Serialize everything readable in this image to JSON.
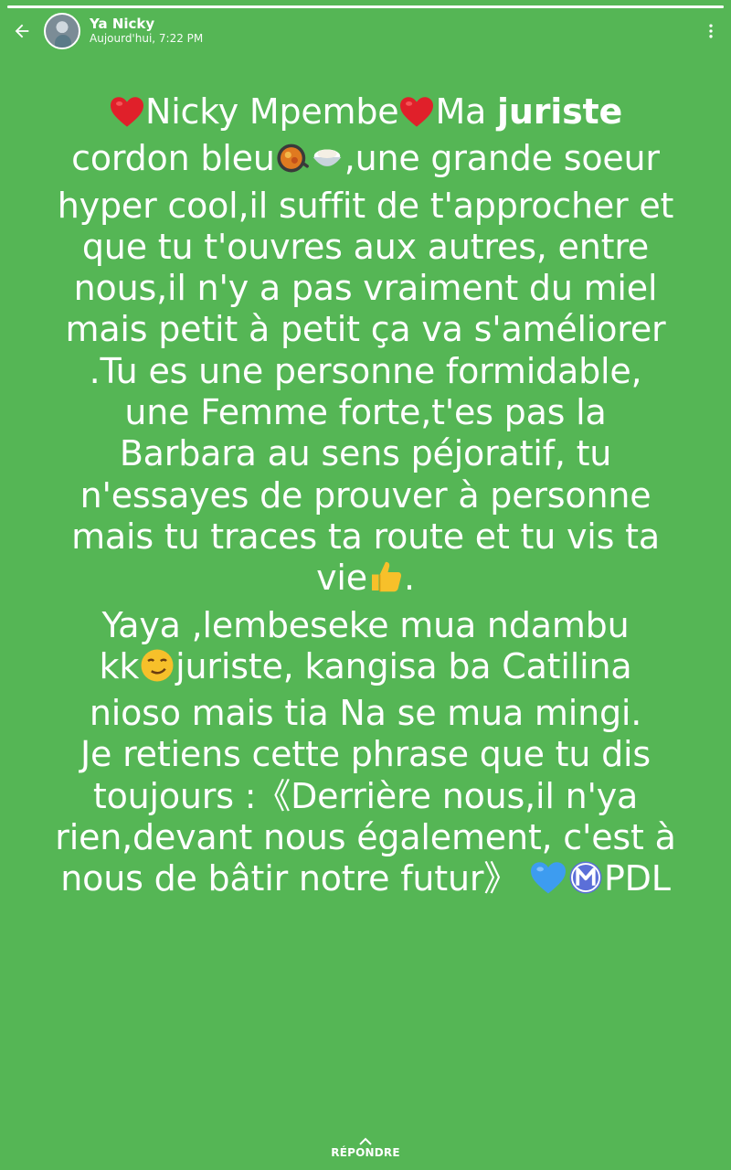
{
  "header": {
    "contact_name": "Ya Nicky",
    "timestamp": "Aujourd'hui, 7:22 PM",
    "back_icon": "arrow-left-icon",
    "menu_icon": "more-vertical-icon"
  },
  "progress": {
    "fraction": 1.0
  },
  "status": {
    "line_1_pre": "Nicky Mpembe",
    "line_1_mid": "Ma ",
    "line_1_bold": "juriste",
    "line_2_pre": "cordon bleu",
    "line_2_post": ",une grande soeur",
    "line_3": "hyper cool,il suffit de t'approcher et",
    "line_4": "que tu t'ouvres aux autres, entre",
    "line_5": "nous,il n'y a pas vraiment du miel",
    "line_6": "mais petit à petit ça va s'améliorer",
    "line_7": ".Tu es une personne formidable,",
    "line_8": "une Femme forte,t'es pas la",
    "line_9": "Barbara au sens péjoratif, tu",
    "line_10": "n'essayes de prouver à personne",
    "line_11": "mais tu traces ta route et tu vis ta",
    "line_12_pre": "vie",
    "line_12_post": ".",
    "line_13": "Yaya ,lembeseke mua ndambu",
    "line_14_pre": "kk",
    "line_14_post": "juriste, kangisa ba Catilina",
    "line_15": "nioso mais tia Na se mua mingi.",
    "line_16": "Je retiens cette phrase que tu dis",
    "line_17": "toujours :《Derrière nous,il n'ya",
    "line_18": "rien,devant nous également, c'est à",
    "line_19_pre": "nous de bâtir notre futur》 ",
    "line_19_post": "PDL"
  },
  "emoji_names": [
    "red-heart-icon",
    "shallow-pan-food-icon",
    "rice-bowl-icon",
    "thumbs-up-icon",
    "smirking-face-icon",
    "blue-heart-icon",
    "circled-m-icon"
  ],
  "colors": {
    "background": "#55b655",
    "text": "#ffffff",
    "heart_red": "#e0202a",
    "heart_blue": "#3d9cf0",
    "m_circle": "#5b6fd8",
    "thumb": "#f7c02a"
  },
  "reply": {
    "label": "RÉPONDRE",
    "icon": "chevron-up-icon"
  }
}
